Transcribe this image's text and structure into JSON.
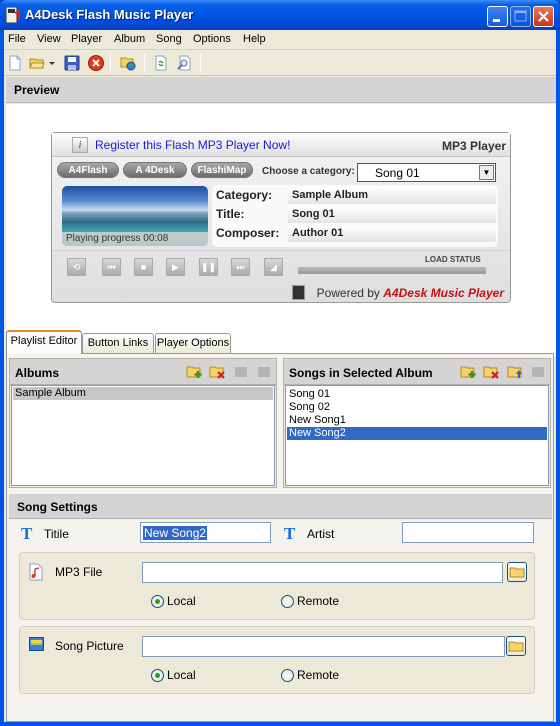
{
  "window": {
    "title": "A4Desk Flash Music Player",
    "controls": [
      "minimize",
      "maximize",
      "close"
    ]
  },
  "menubar": [
    "File",
    "View",
    "Player",
    "Album",
    "Song",
    "Options",
    "Help"
  ],
  "toolbar": {
    "icons": [
      "new-file-icon",
      "open-folder-icon",
      "dropdown-arrow-icon",
      "save-icon",
      "close-red-icon",
      "publish-web-icon",
      "refresh-icon",
      "preview-icon"
    ]
  },
  "preview": {
    "header": "Preview",
    "player": {
      "register_link": "Register this Flash MP3 Player Now!",
      "brand": "MP3 Player",
      "link_buttons": [
        "A4Flash",
        "A 4Desk",
        "FlashiMap"
      ],
      "category_label": "Choose a category:",
      "category_value": "Song 01",
      "progress_text": "Playing progress 00:08",
      "meta": [
        {
          "key": "Category:",
          "value": "Sample Album"
        },
        {
          "key": "Title:",
          "value": "Song 01"
        },
        {
          "key": "Composer:",
          "value": "Author 01"
        }
      ],
      "controls": [
        "repeat",
        "previous",
        "stop",
        "play",
        "pause",
        "next",
        "volume"
      ],
      "load_status_label": "LOAD STATUS",
      "powered_prefix": "Powered by ",
      "powered_brand": "A4Desk Music Player"
    }
  },
  "tabs": [
    {
      "label": "Playlist Editor",
      "active": true
    },
    {
      "label": "Button Links",
      "active": false
    },
    {
      "label": "Player Options",
      "active": false
    }
  ],
  "albums": {
    "header": "Albums",
    "items": [
      "Sample Album"
    ],
    "selected": 0
  },
  "songs": {
    "header": "Songs in Selected Album",
    "items": [
      "Song 01",
      "Song 02",
      "New Song1",
      "New Song2"
    ],
    "selected": 3
  },
  "song_settings": {
    "header": "Song Settings",
    "title_label": "Titile",
    "title_value": "New Song2",
    "artist_label": "Artist",
    "artist_value": "",
    "mp3_label": "MP3 File",
    "mp3_value": "",
    "mp3_source": {
      "local": "Local",
      "remote": "Remote",
      "selected": "Local"
    },
    "picture_label": "Song Picture",
    "picture_value": "",
    "picture_source": {
      "local": "Local",
      "remote": "Remote",
      "selected": "Local"
    }
  }
}
